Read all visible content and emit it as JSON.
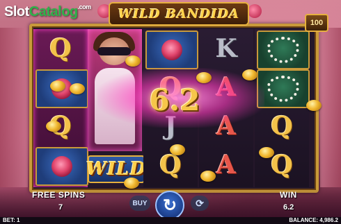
{
  "watermark": {
    "part1": "Slot",
    "part2": "Catalog",
    "suffix": ".com"
  },
  "title": "WILD BANDIDA",
  "lines_badge": "100",
  "reels": [
    [
      "Q",
      "rose",
      "Q",
      "rose"
    ],
    [
      "bandit",
      "bandit",
      "bandit",
      "WILD"
    ],
    [
      "rose",
      "Q",
      "J",
      "Q"
    ],
    [
      "K",
      "A",
      "A",
      "A"
    ],
    [
      "pearls",
      "pearls",
      "Q",
      "Q"
    ]
  ],
  "wild_label": "WILD",
  "win_display": "6.2",
  "free_spins": {
    "label": "FREE SPINS",
    "value": "7"
  },
  "win": {
    "label": "WIN",
    "value": "6.2"
  },
  "buttons": {
    "buy": "BUY",
    "spin_icon": "refresh-icon",
    "autoplay_icon": "autoplay-icon"
  },
  "footer": {
    "bet_label": "BET: 1",
    "balance_label": "BALANCE: 4,986.2"
  },
  "colors": {
    "gold": "#f3c24a",
    "accent_pink": "#ff3cc8",
    "spin_blue": "#2a5ac0"
  }
}
